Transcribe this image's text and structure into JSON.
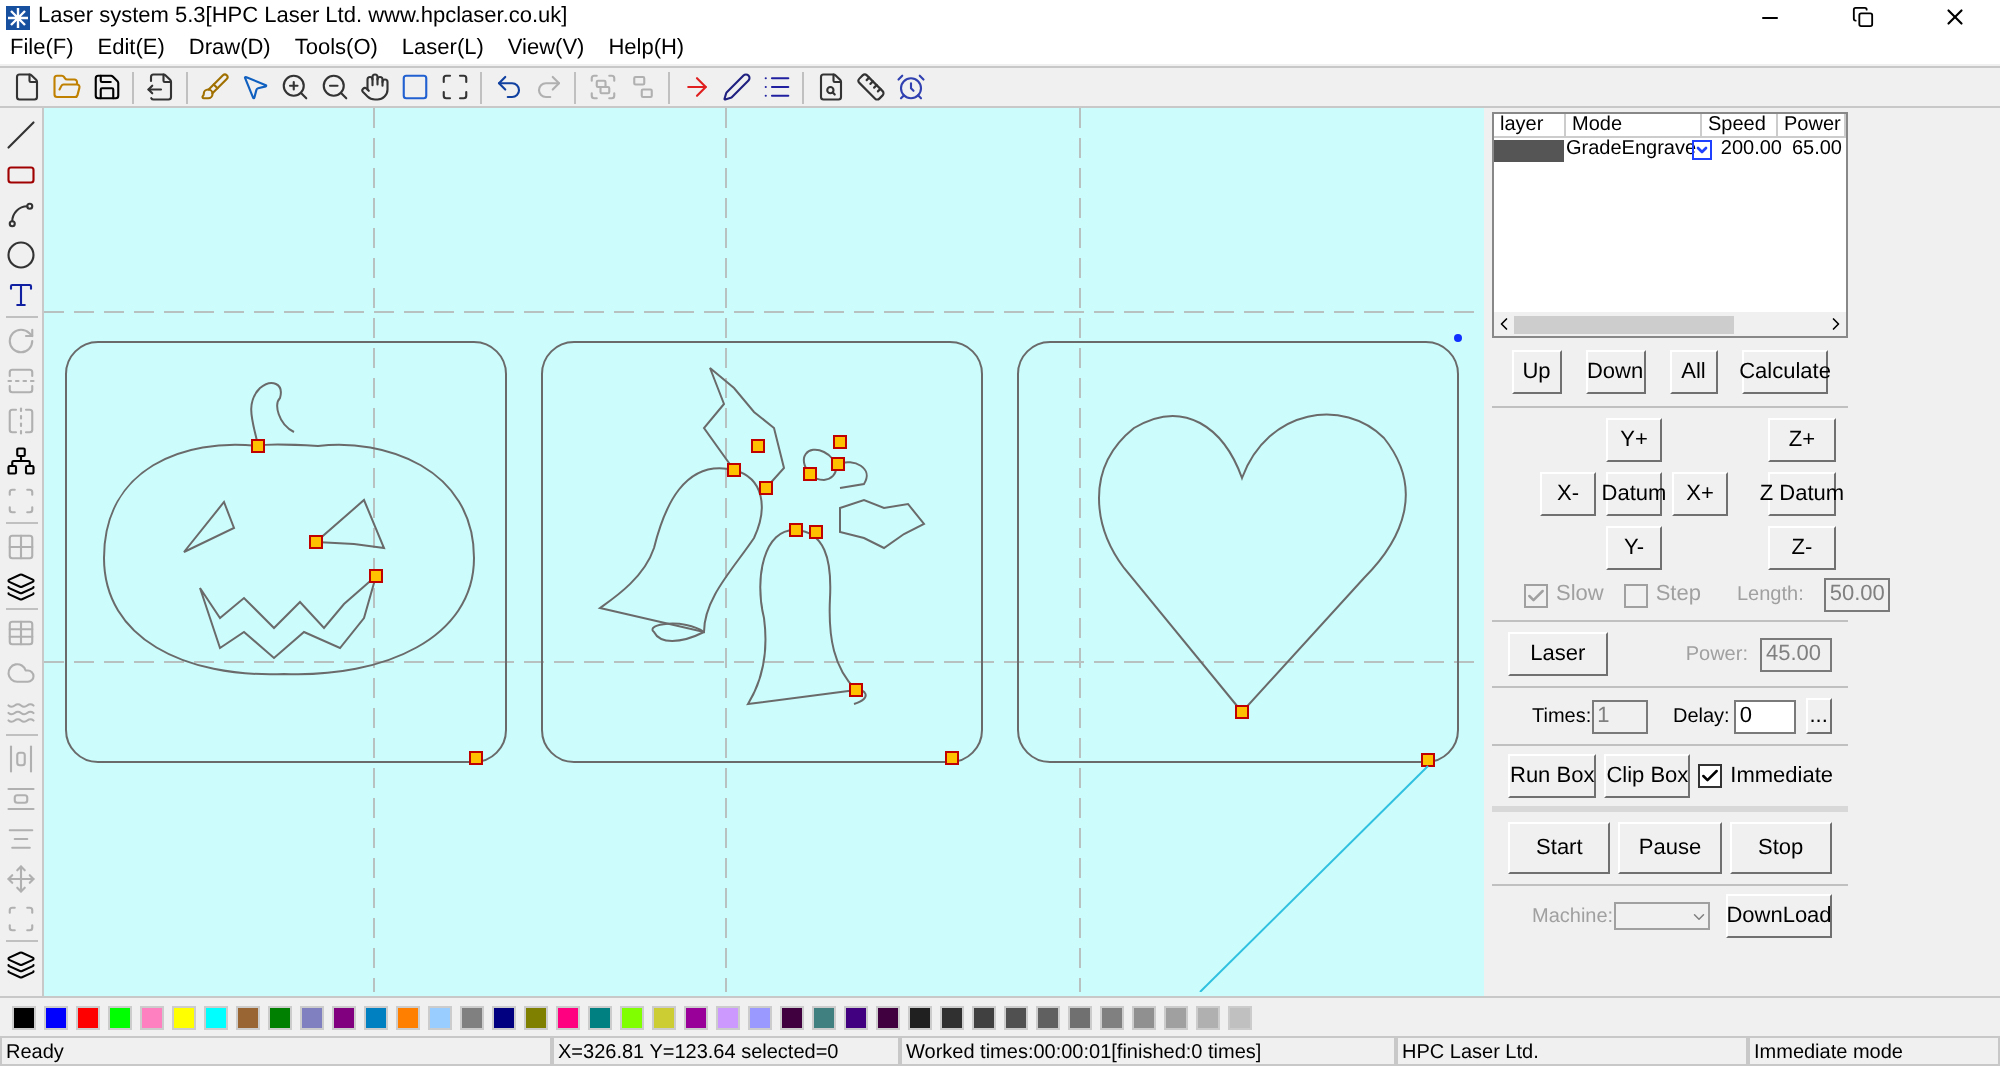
{
  "window": {
    "title": "Laser system 5.3[HPC Laser Ltd. www.hpclaser.co.uk]"
  },
  "menu": [
    "File(F)",
    "Edit(E)",
    "Draw(D)",
    "Tools(O)",
    "Laser(L)",
    "View(V)",
    "Help(H)"
  ],
  "layers": {
    "columns": [
      "layer",
      "Mode",
      "Speed",
      "Power"
    ],
    "rows": [
      {
        "color": "#555555",
        "mode": "GradeEngrave",
        "speed": "200.00",
        "power": "65.00"
      }
    ]
  },
  "layer_buttons": [
    "Up",
    "Down",
    "All",
    "Calculate"
  ],
  "move": {
    "y_plus": "Y+",
    "x_minus": "X-",
    "datum": "Datum",
    "x_plus": "X+",
    "y_minus": "Y-",
    "z_plus": "Z+",
    "z_datum": "Z Datum",
    "z_minus": "Z-"
  },
  "options": [
    {
      "label": "Slow",
      "checked": true,
      "disabled": true
    },
    {
      "label": "Step",
      "checked": false,
      "disabled": true
    }
  ],
  "length": {
    "label": "Length:",
    "value": "50.00"
  },
  "laser": {
    "button": "Laser",
    "power_label": "Power:",
    "power_value": "45.00"
  },
  "times": {
    "label": "Times:",
    "value": "1"
  },
  "delay": {
    "label": "Delay:",
    "value": "0",
    "more": "..."
  },
  "box_buttons": [
    "Run Box",
    "Clip Box"
  ],
  "immediate": {
    "label": "Immediate",
    "checked": true
  },
  "run_buttons": [
    "Start",
    "Pause",
    "Stop"
  ],
  "machine": {
    "label": "Machine:"
  },
  "download": "DownLoad",
  "palette": [
    {
      "color": "#000000"
    },
    {
      "color": "#0000ff"
    },
    {
      "color": "#ff0000"
    },
    {
      "color": "#00ff00"
    },
    {
      "color": "#ff80c0"
    },
    {
      "color": "#ffff00"
    },
    {
      "color": "#00ffff"
    },
    {
      "color": "#996633"
    },
    {
      "color": "#008000"
    },
    {
      "color": "#8080c0"
    },
    {
      "color": "#800080"
    },
    {
      "color": "#0080c0"
    },
    {
      "color": "#ff8000"
    },
    {
      "color": "#99ccff"
    },
    {
      "color": "#808080"
    },
    {
      "color": "#000080"
    },
    {
      "color": "#808000"
    },
    {
      "color": "#ff0080"
    },
    {
      "color": "#008080"
    },
    {
      "color": "#80ff00"
    },
    {
      "color": "#cccc33"
    },
    {
      "color": "#990099"
    },
    {
      "color": "#cc99ff"
    },
    {
      "color": "#9999ff"
    },
    {
      "color": "#400040"
    },
    {
      "color": "#408080"
    },
    {
      "color": "#400080"
    },
    {
      "color": "#400040"
    },
    {
      "color": "#202020"
    },
    {
      "color": "#303030"
    },
    {
      "color": "#404040"
    },
    {
      "color": "#505050"
    },
    {
      "color": "#606060"
    },
    {
      "color": "#707070"
    },
    {
      "color": "#808080"
    },
    {
      "color": "#909090"
    },
    {
      "color": "#a0a0a0"
    },
    {
      "color": "#b0b0b0"
    },
    {
      "color": "#c0c0c0"
    }
  ],
  "status_bar": [
    "Ready",
    "X=326.81 Y=123.64 selected=0",
    "Worked times:00:00:01[finished:0 times]",
    "HPC Laser Ltd.",
    "Immediate mode"
  ]
}
